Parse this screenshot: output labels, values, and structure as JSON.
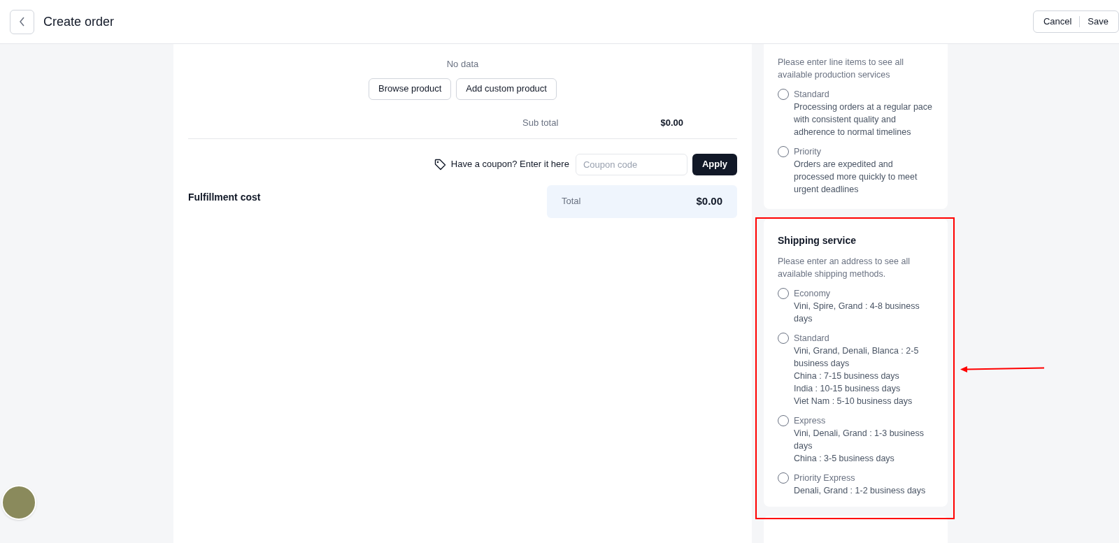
{
  "header": {
    "title": "Create order",
    "actions": [
      "Cancel",
      "Save"
    ]
  },
  "products": {
    "empty_text": "No data",
    "buttons": [
      "Browse product",
      "Add custom product"
    ]
  },
  "subtotal": {
    "label": "Sub total",
    "value": "$0.00"
  },
  "coupon": {
    "prompt": "Have a coupon? Enter it here",
    "placeholder": "Coupon code",
    "button": "Apply"
  },
  "fulfillment": {
    "title": "Fulfillment cost",
    "total_label": "Total",
    "total_value": "$0.00"
  },
  "production_service": {
    "note": "Please enter line items to see all available production services",
    "options": [
      {
        "name": "Standard",
        "selected": false,
        "details": [
          "Processing orders at a regular pace with consistent quality and adherence to normal timelines"
        ]
      },
      {
        "name": "Priority",
        "selected": false,
        "details": [
          "Orders are expedited and processed more quickly to meet urgent deadlines"
        ]
      }
    ]
  },
  "shipping_service": {
    "title": "Shipping service",
    "note": "Please enter an address to see all available shipping methods.",
    "options": [
      {
        "name": "Economy",
        "selected": false,
        "details": [
          "Vini, Spire, Grand : 4-8 business days"
        ]
      },
      {
        "name": "Standard",
        "selected": false,
        "details": [
          "Vini, Grand, Denali, Blanca : 2-5 business days",
          "China : 7-15 business days",
          "India : 10-15 business days",
          "Viet Nam : 5-10 business days"
        ]
      },
      {
        "name": "Express",
        "selected": false,
        "details": [
          "Vini, Denali, Grand : 1-3 business days",
          "China : 3-5 business days"
        ]
      },
      {
        "name": "Priority Express",
        "selected": false,
        "details": [
          "Denali, Grand : 1-2 business days"
        ]
      }
    ]
  }
}
